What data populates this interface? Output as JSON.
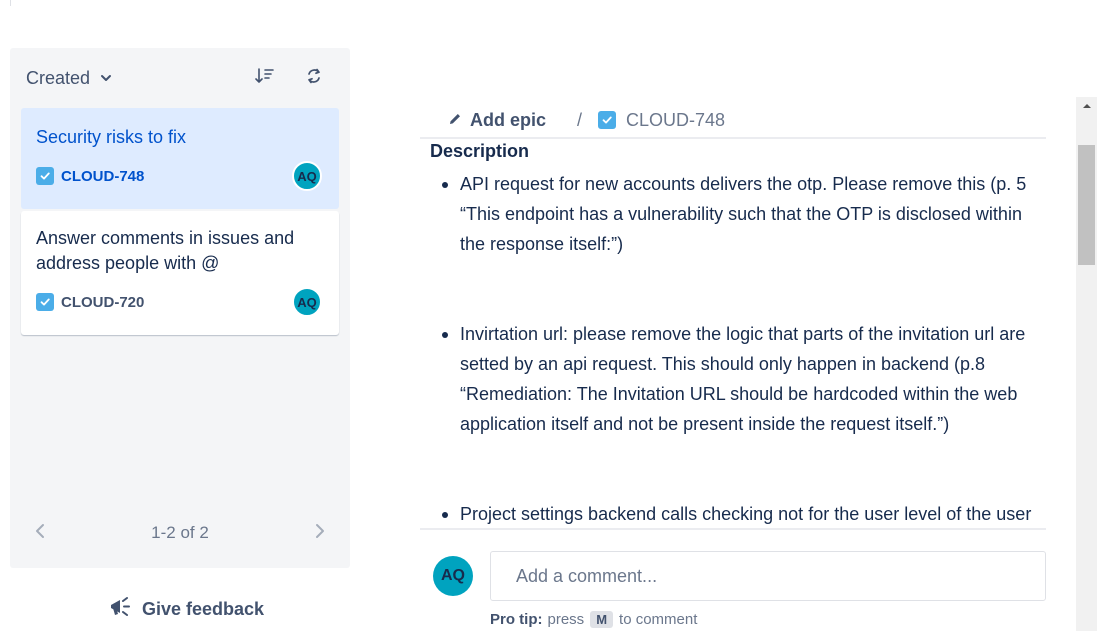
{
  "sidebar": {
    "sort_label": "Created",
    "cards": [
      {
        "title": "Security risks to fix",
        "key": "CLOUD-748",
        "assignee": "AQ"
      },
      {
        "title": "Answer comments in issues and address people with @",
        "key": "CLOUD-720",
        "assignee": "AQ"
      }
    ],
    "pagination": "1-2 of 2",
    "feedback_label": "Give feedback"
  },
  "breadcrumb": {
    "add_epic": "Add epic",
    "separator": "/",
    "issue_key": "CLOUD-748"
  },
  "description": {
    "title": "Description",
    "bullets": [
      "API request for new accounts delivers the otp. Please remove this (p. 5 “This endpoint has a vulnerability such that the OTP is disclosed within the response itself:”)",
      "Invirtation url: please remove the logic that parts of the invitation url are setted by an api request. This should only happen in backend (p.8 “Remediation: The Invitation URL should be hardcoded within the web application itself and not be present inside the request itself.”)",
      "Project settings backend calls checking not for the user level of the user"
    ]
  },
  "comment": {
    "avatar": "AQ",
    "placeholder": "Add a comment...",
    "protip_label": "Pro tip:",
    "protip_press": "press",
    "protip_key": "M",
    "protip_suffix": "to comment"
  },
  "colors": {
    "selected_card": "#deebff",
    "link_blue": "#0052cc",
    "avatar": "#00a3bf",
    "checkbox": "#4bade8"
  },
  "icons": [
    "chevron-down-icon",
    "sort-icon",
    "refresh-icon",
    "checkbox-icon",
    "chevron-left-icon",
    "chevron-right-icon",
    "megaphone-icon",
    "pencil-icon",
    "scroll-up-icon"
  ]
}
